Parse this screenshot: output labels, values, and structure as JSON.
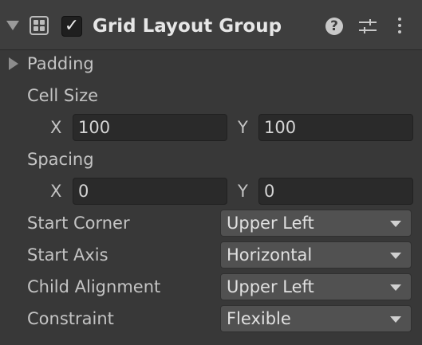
{
  "component": {
    "title": "Grid Layout Group",
    "enabled_mark": "✓",
    "help_glyph": "?"
  },
  "padding": {
    "label": "Padding"
  },
  "cell_size": {
    "label": "Cell Size",
    "x_label": "X",
    "x_value": "100",
    "y_label": "Y",
    "y_value": "100"
  },
  "spacing": {
    "label": "Spacing",
    "x_label": "X",
    "x_value": "0",
    "y_label": "Y",
    "y_value": "0"
  },
  "start_corner": {
    "label": "Start Corner",
    "value": "Upper Left"
  },
  "start_axis": {
    "label": "Start Axis",
    "value": "Horizontal"
  },
  "child_alignment": {
    "label": "Child Alignment",
    "value": "Upper Left"
  },
  "constraint": {
    "label": "Constraint",
    "value": "Flexible"
  },
  "icons": [
    "foldout-down-icon",
    "grid-layout-icon",
    "help-icon",
    "presets-icon",
    "context-menu-icon",
    "foldout-right-icon",
    "dropdown-caret-icon"
  ],
  "colors": {
    "background": "#383838",
    "header": "#3e3e3e",
    "field": "#2a2a2a",
    "dropdown": "#515151",
    "text": "#c4c4c4"
  }
}
